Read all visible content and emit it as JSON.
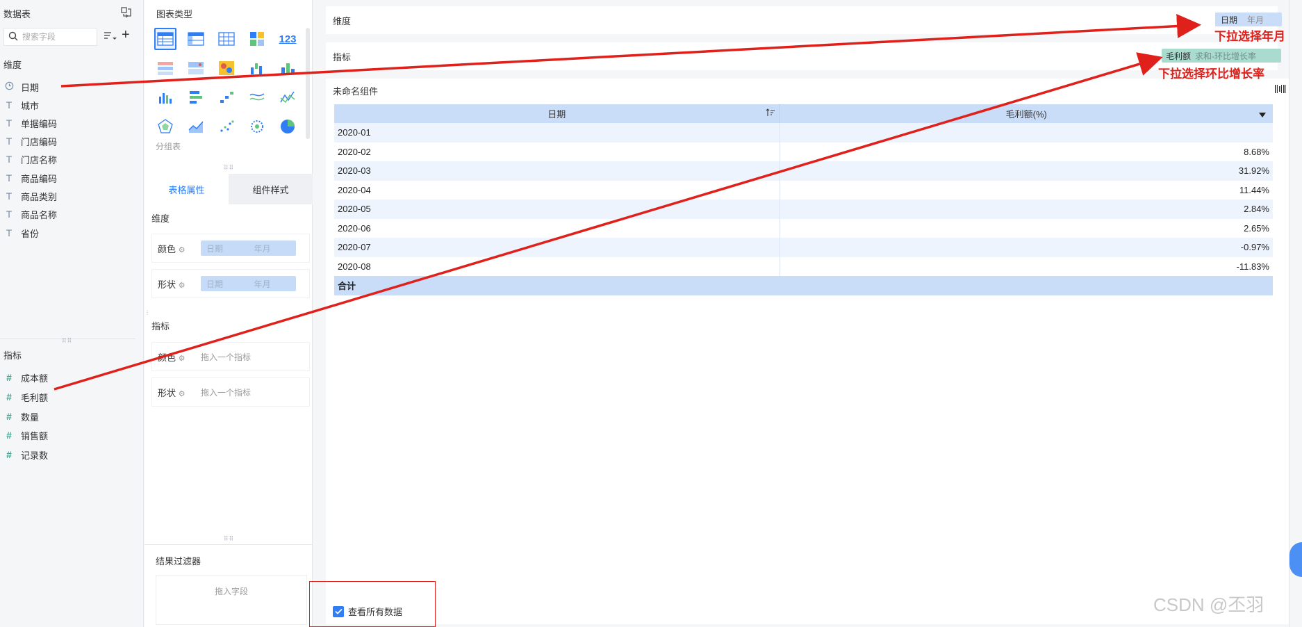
{
  "left_panel": {
    "title": "数据表",
    "search_placeholder": "搜索字段",
    "dimension_label": "维度",
    "dimensions": [
      {
        "label": "日期",
        "icon": "clock-icon"
      },
      {
        "label": "城市",
        "icon": "text-type-icon"
      },
      {
        "label": "单据编码",
        "icon": "text-type-icon"
      },
      {
        "label": "门店编码",
        "icon": "text-type-icon"
      },
      {
        "label": "门店名称",
        "icon": "text-type-icon"
      },
      {
        "label": "商品编码",
        "icon": "text-type-icon"
      },
      {
        "label": "商品类别",
        "icon": "text-type-icon"
      },
      {
        "label": "商品名称",
        "icon": "text-type-icon"
      },
      {
        "label": "省份",
        "icon": "text-type-icon"
      }
    ],
    "measure_label": "指标",
    "measures": [
      {
        "label": "成本额",
        "icon": "hash-icon"
      },
      {
        "label": "毛利额",
        "icon": "hash-icon"
      },
      {
        "label": "数量",
        "icon": "hash-icon"
      },
      {
        "label": "销售额",
        "icon": "hash-icon"
      },
      {
        "label": "记录数",
        "icon": "hash-icon"
      }
    ]
  },
  "mid_panel": {
    "chart_type_label": "图表类型",
    "group_table_label": "分组表",
    "tabs": [
      "表格属性",
      "组件样式"
    ],
    "dimension_label": "维度",
    "dim_color_label": "颜色",
    "dim_shape_label": "形状",
    "pill_field": "日期",
    "pill_granularity": "年月",
    "measure_label": "指标",
    "measure_color_label": "颜色",
    "measure_shape_label": "形状",
    "drop_measure_hint": "拖入一个指标",
    "result_filter_label": "结果过滤器",
    "drop_field_hint": "拖入字段"
  },
  "right_area": {
    "dimension_shelf_label": "维度",
    "dimension_pill_field": "日期",
    "dimension_pill_granularity": "年月",
    "measure_shelf_label": "指标",
    "measure_pill_field": "毛利额",
    "measure_pill_calc": "求和-环比增长率",
    "component_title": "未命名组件",
    "table": {
      "headers": [
        "日期",
        "毛利额(%)"
      ],
      "rows": [
        {
          "date": "2020-01",
          "value": ""
        },
        {
          "date": "2020-02",
          "value": "8.68%"
        },
        {
          "date": "2020-03",
          "value": "31.92%"
        },
        {
          "date": "2020-04",
          "value": "11.44%"
        },
        {
          "date": "2020-05",
          "value": "2.84%"
        },
        {
          "date": "2020-06",
          "value": "2.65%"
        },
        {
          "date": "2020-07",
          "value": "-0.97%"
        },
        {
          "date": "2020-08",
          "value": "-11.83%"
        }
      ],
      "total_label": "合计"
    },
    "view_all_label": "查看所有数据",
    "view_all_checked": true
  },
  "annotations": {
    "year_month_note": "下拉选择年月",
    "mom_note": "下拉选择环比增长率",
    "color": "#e0201b"
  },
  "watermark": "CSDN @丕羽",
  "colors": {
    "accent": "#2f7ef5",
    "table_header": "#c9ddf8",
    "measure_pill": "#a9dccf"
  }
}
